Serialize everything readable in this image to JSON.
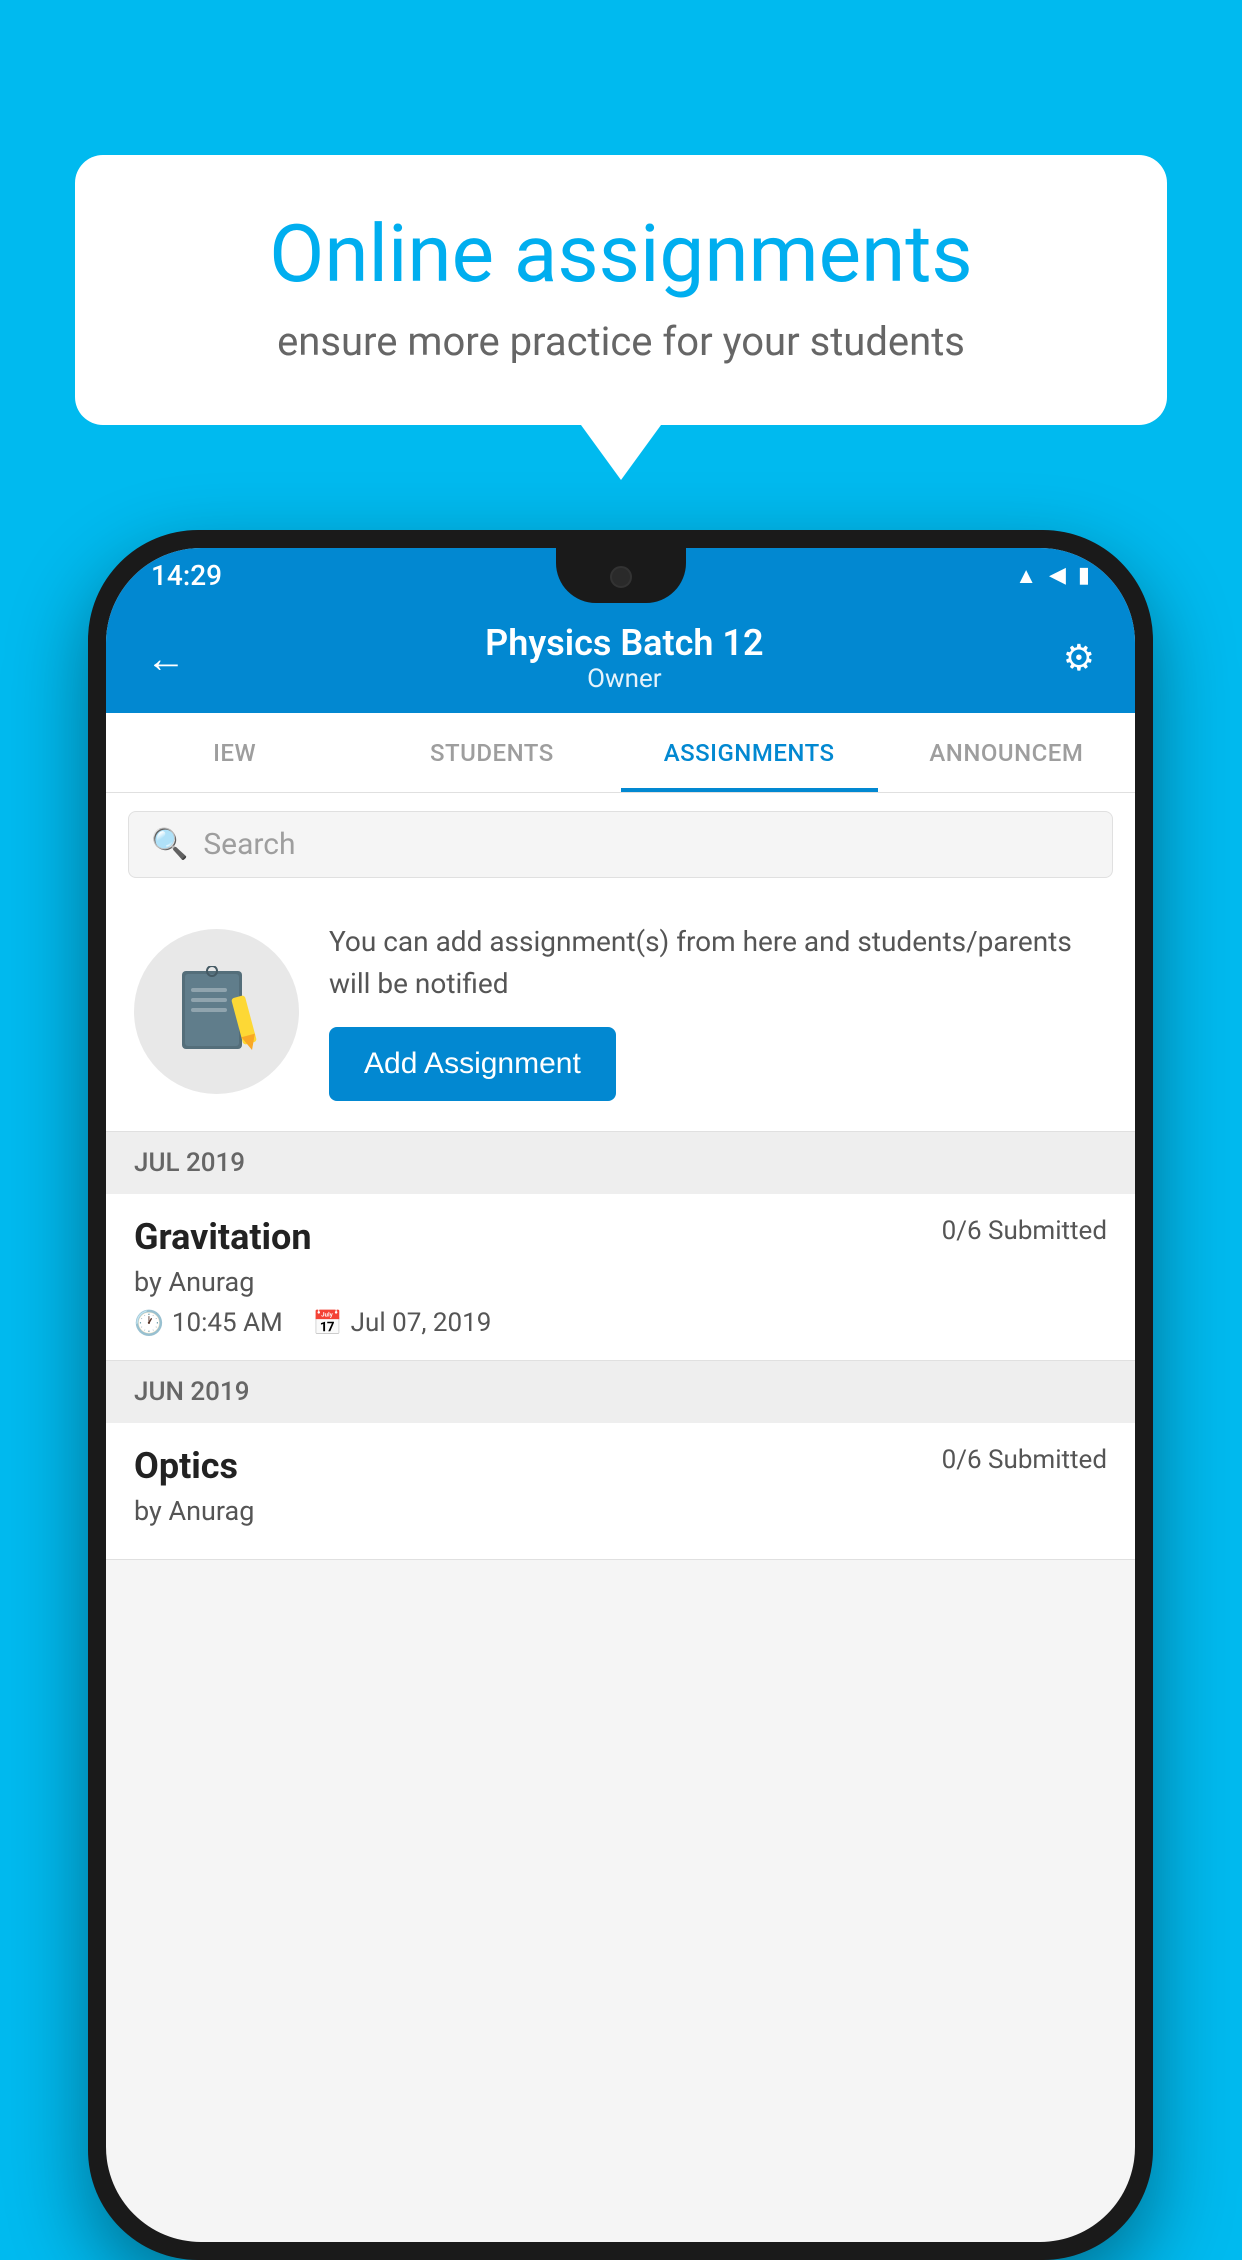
{
  "background_color": "#00BAEF",
  "speech_bubble": {
    "title": "Online assignments",
    "subtitle": "ensure more practice for your students"
  },
  "status_bar": {
    "time": "14:29",
    "icons": [
      "wifi",
      "signal",
      "battery"
    ]
  },
  "app_bar": {
    "title": "Physics Batch 12",
    "subtitle": "Owner",
    "back_label": "←",
    "settings_label": "⚙"
  },
  "tabs": [
    {
      "label": "IEW",
      "active": false
    },
    {
      "label": "STUDENTS",
      "active": false
    },
    {
      "label": "ASSIGNMENTS",
      "active": true
    },
    {
      "label": "ANNOUNCEME",
      "active": false
    }
  ],
  "search": {
    "placeholder": "Search"
  },
  "info_card": {
    "text": "You can add assignment(s) from here and students/parents will be notified",
    "button_label": "Add Assignment"
  },
  "sections": [
    {
      "header": "JUL 2019",
      "assignments": [
        {
          "name": "Gravitation",
          "submitted": "0/6 Submitted",
          "by": "by Anurag",
          "time": "10:45 AM",
          "date": "Jul 07, 2019"
        }
      ]
    },
    {
      "header": "JUN 2019",
      "assignments": [
        {
          "name": "Optics",
          "submitted": "0/6 Submitted",
          "by": "by Anurag",
          "time": "",
          "date": ""
        }
      ]
    }
  ]
}
